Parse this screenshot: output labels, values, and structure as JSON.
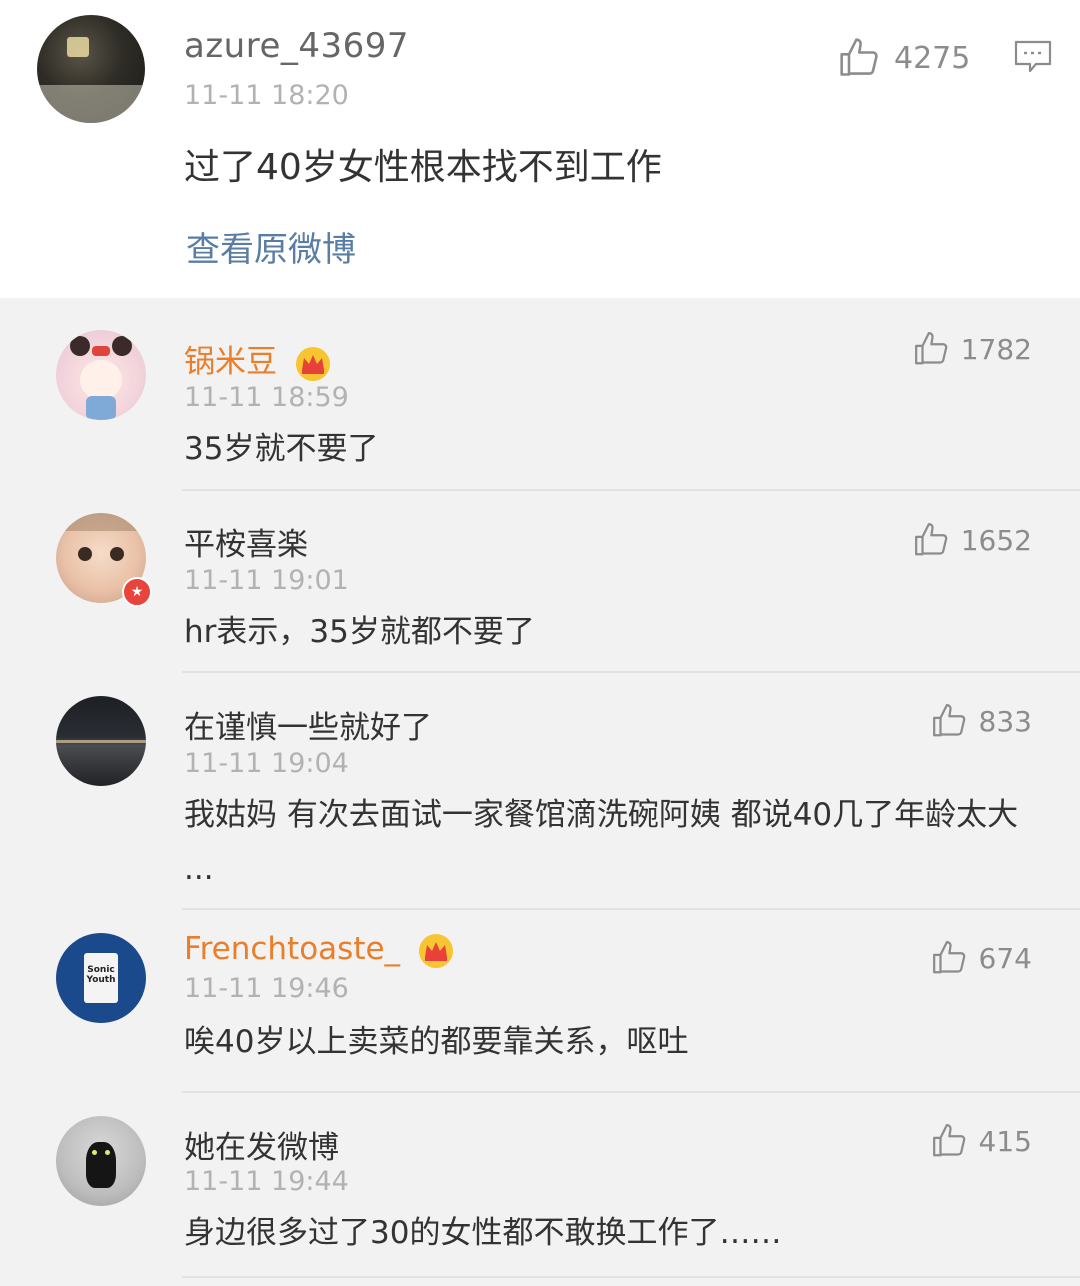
{
  "post": {
    "username": "azure_43697",
    "time": "11-11 18:20",
    "text": "过了40岁女性根本找不到工作",
    "like_count": "4275",
    "view_original": "查看原微博"
  },
  "comments": [
    {
      "username": "锅米豆",
      "vip": true,
      "time": "11-11 18:59",
      "text": "35岁就不要了",
      "likes": "1782"
    },
    {
      "username": "平桉喜楽",
      "vip": false,
      "time": "11-11 19:01",
      "text": "hr表示，35岁就都不要了",
      "likes": "1652"
    },
    {
      "username": "在谨慎一些就好了",
      "vip": false,
      "time": "11-11 19:04",
      "text": "我姑妈 有次去面试一家餐馆滴洗碗阿姨 都说40几了年龄太大 ...",
      "likes": "833"
    },
    {
      "username": "Frenchtoaste_",
      "vip": true,
      "time": "11-11 19:46",
      "text": "唉40岁以上卖菜的都要靠关系，呕吐",
      "likes": "674"
    },
    {
      "username": "她在发微博",
      "vip": false,
      "time": "11-11 19:44",
      "text": "身边很多过了30的女性都不敢换工作了……",
      "likes": "415"
    }
  ],
  "avatar5_text": "Sonic Youth",
  "colors": {
    "vip_name": "#ea7e2a",
    "link": "#5a7da6",
    "meta": "#b2b2b2"
  }
}
